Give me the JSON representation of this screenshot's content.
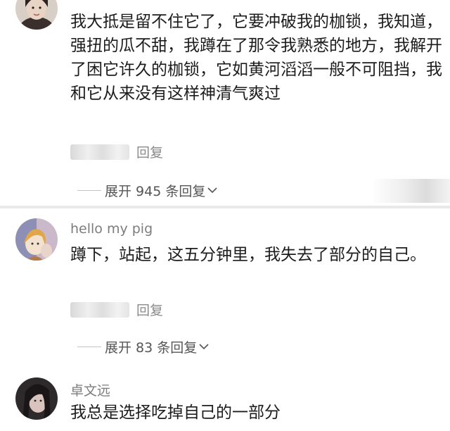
{
  "comments": [
    {
      "username": "",
      "text": "我大抵是留不住它了，它要冲破我的枷锁，我知道，强扭的瓜不甜，我蹲在了那令我熟悉的地方，我解开了困它许久的枷锁，它如黄河滔滔一般不可阻挡，我和它从来没有这样神清气爽过",
      "reply_label": "回复",
      "expand_label": "展开 945 条回复"
    },
    {
      "username": "hello my pig",
      "text": "蹲下，站起，这五分钟里，我失去了部分的自己。",
      "reply_label": "回复",
      "expand_label": "展开 83 条回复"
    },
    {
      "username": "卓文远",
      "text": "我总是选择吃掉自己的一部分"
    }
  ],
  "colors": {
    "text": "#1c1c1c",
    "username": "#7d7d7d",
    "secondary": "#8a8a8a",
    "divider": "#e9e9e9"
  },
  "icons": [
    "chevron-down-icon",
    "avatar"
  ]
}
